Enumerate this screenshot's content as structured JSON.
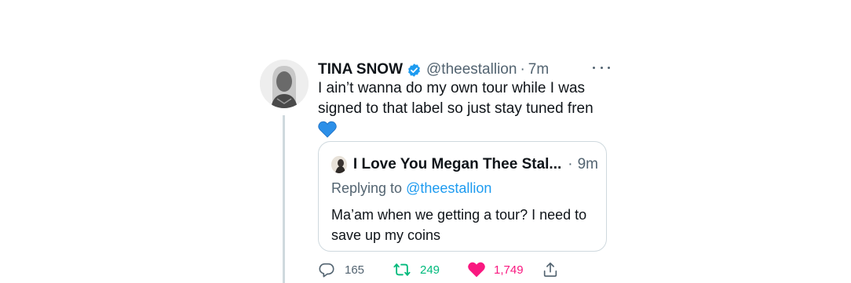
{
  "tweet": {
    "author_name": "TINA SNOW",
    "handle": "@theestallion",
    "separator": "·",
    "time": "7m",
    "text": "I ain’t wanna do my own tour while I was signed to that label so just stay tuned fren",
    "emoji": "💙"
  },
  "quote": {
    "author_name": "I Love You Megan Thee Stal...",
    "separator": "·",
    "time": "9m",
    "replying_prefix": "Replying to ",
    "replying_handle": "@theestallion",
    "text": "Ma’am when we getting a tour? I need to save up my coins"
  },
  "actions": {
    "replies": "165",
    "retweets": "249",
    "likes": "1,749"
  },
  "colors": {
    "verified": "#1d9bf0",
    "retweet": "#00ba7c",
    "like": "#f91880",
    "secondary_text": "#536471",
    "link": "#1d9bf0"
  },
  "icons": [
    "verified-badge-icon",
    "more-icon",
    "reply-icon",
    "retweet-icon",
    "like-icon",
    "share-icon"
  ]
}
